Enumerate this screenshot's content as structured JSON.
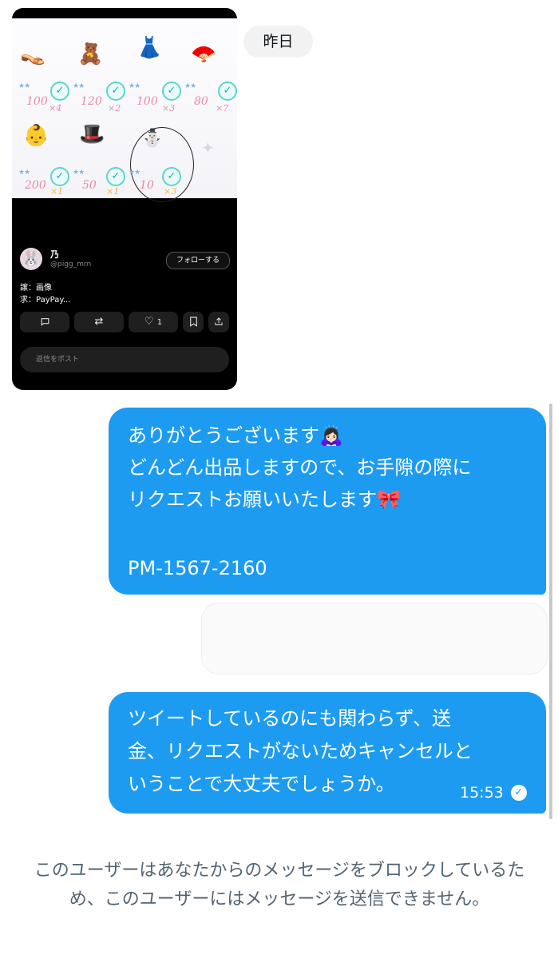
{
  "post": {
    "items_row1": [
      {
        "icon": "pink-slippers",
        "count": "100",
        "mult": "×4"
      },
      {
        "icon": "pink-fluffy-item",
        "count": "120",
        "mult": "×2"
      },
      {
        "icon": "black-outfit",
        "count": "100",
        "mult": "×3"
      },
      {
        "icon": "blue-frilly-item",
        "count": "80",
        "mult": "×7"
      }
    ],
    "items_row2": [
      {
        "icon": "baby-doll",
        "count": "200",
        "mult": "×1"
      },
      {
        "icon": "grey-hat-item",
        "count": "50",
        "mult": "×1"
      },
      {
        "icon": "white-figure",
        "count": "10",
        "mult": "×3"
      }
    ],
    "stars": "★★",
    "check": "✓",
    "user_name": "乃",
    "user_handle": "@pigg_mrn",
    "follow_label": "フォローする",
    "text_line1": "譲：画像",
    "text_line2": "求：PayPay...",
    "like_count": "1",
    "reply_placeholder": "返信をポスト"
  },
  "date_label": "昨日",
  "messages": {
    "m1_lines": [
      "ありがとうございます🙇🏻‍♀️",
      "どんどん出品しますので、お手隙の際に",
      "リクエストお願いいたします🎀",
      "",
      "PM-1567-2160"
    ],
    "m3_lines": [
      "ツイートしているのにも関わらず、送",
      "金、リクエストがないためキャンセルと",
      "いうことで大丈夫でしょうか。"
    ],
    "m3_time": "15:53"
  },
  "notice": "このユーザーはあなたからのメッセージをブロックしているため、このユーザーにはメッセージを送信できません。",
  "colors": {
    "accent": "#1d9bf0",
    "notice_text": "#536471"
  }
}
